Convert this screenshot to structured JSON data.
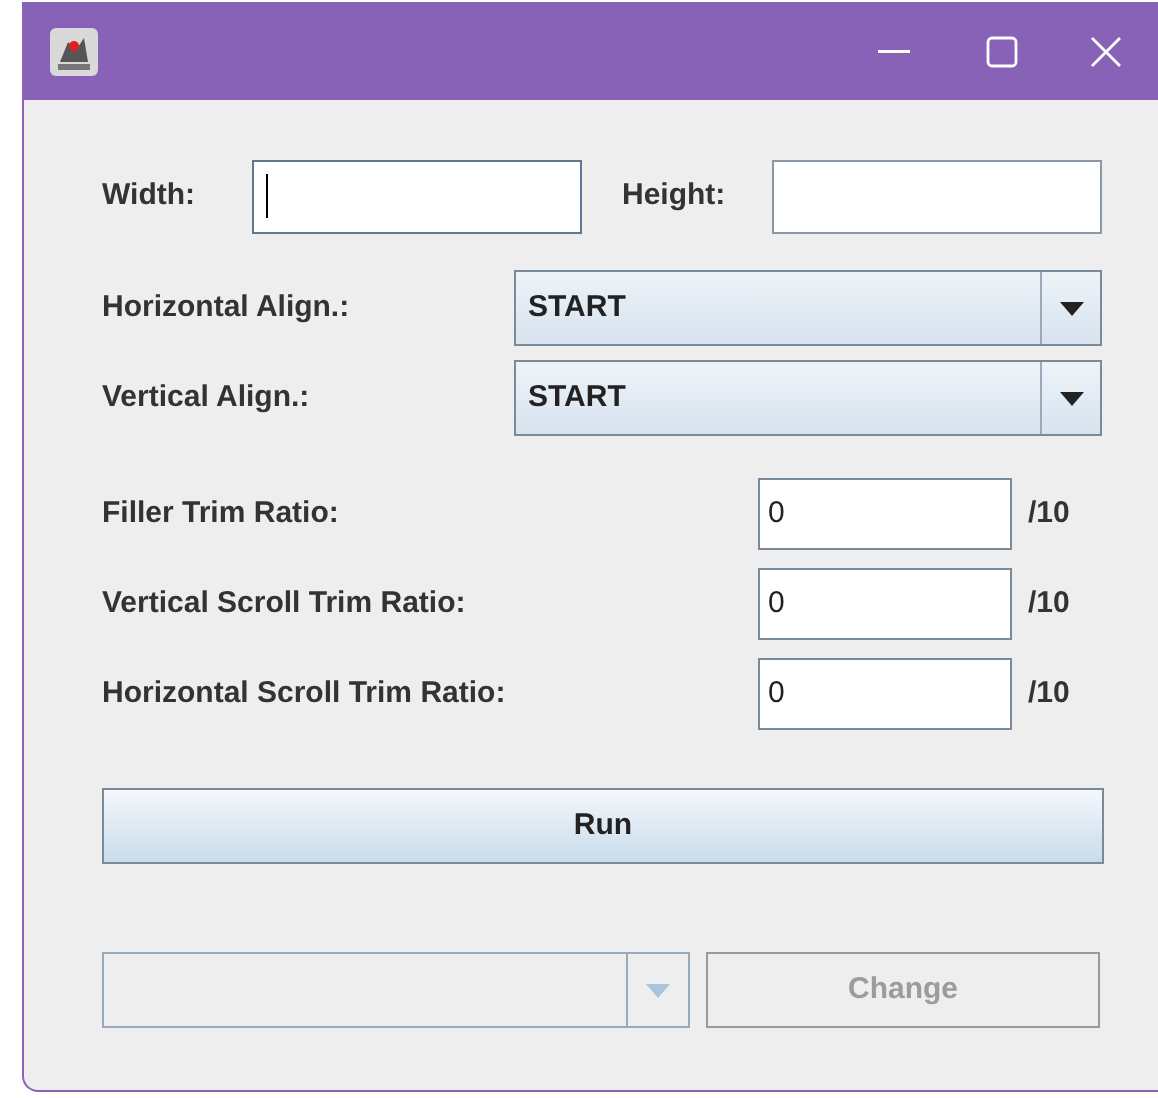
{
  "size_fields": [
    {
      "label": "Width:",
      "focused": true
    },
    {
      "label": "Height:",
      "focused": false
    }
  ],
  "align_selects": [
    {
      "label": "Horizontal Align.:",
      "value": "START"
    },
    {
      "label": "Vertical Align.:",
      "value": "START"
    }
  ],
  "trim_ratios": [
    {
      "label": "Filler Trim Ratio:",
      "value": "0",
      "suffix": "/10"
    },
    {
      "label": "Vertical Scroll Trim Ratio:",
      "value": "0",
      "suffix": "/10"
    },
    {
      "label": "Horizontal Scroll Trim Ratio:",
      "value": "0",
      "suffix": "/10"
    }
  ],
  "run_button": {
    "label": "Run"
  },
  "bottom_select": {
    "disabled": true
  },
  "change_button": {
    "label": "Change",
    "disabled": true
  }
}
